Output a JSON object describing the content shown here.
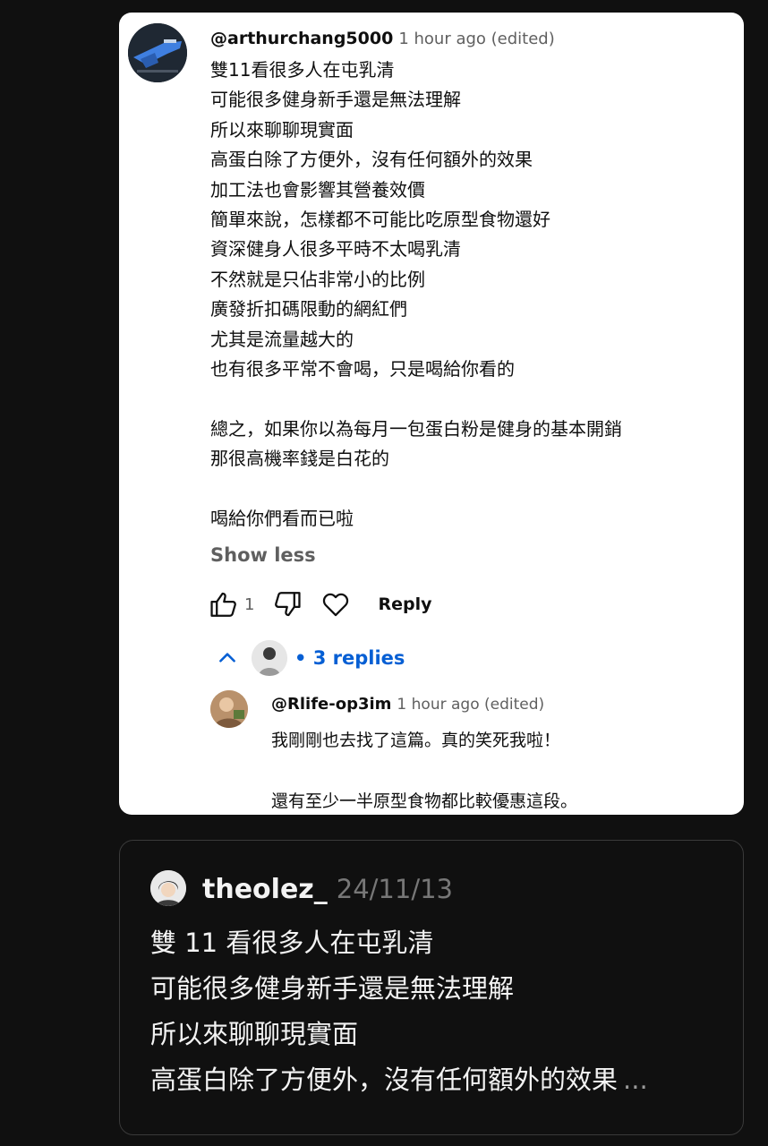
{
  "youtube_comment": {
    "handle": "@arthurchang5000",
    "meta": "1 hour ago (edited)",
    "body_lines": [
      "雙11看很多人在屯乳清",
      "可能很多健身新手還是無法理解",
      "所以來聊聊現實面",
      "高蛋白除了方便外，沒有任何額外的效果",
      "加工法也會影響其營養效價",
      "簡單來說，怎樣都不可能比吃原型食物還好",
      "資深健身人很多平時不太喝乳清",
      "不然就是只佔非常小的比例",
      "廣發折扣碼限動的網紅們",
      "尤其是流量越大的",
      "也有很多平常不會喝，只是喝給你看的",
      "",
      "總之，如果你以為每月一包蛋白粉是健身的基本開銷",
      "那很高機率錢是白花的",
      "",
      "喝給你們看而已啦"
    ],
    "show_less": "Show less",
    "like_count": "1",
    "reply_label": "Reply",
    "replies_label": "• 3 replies",
    "reply": {
      "handle": "@Rlife-op3im",
      "meta": "1 hour ago (edited)",
      "body_lines": [
        "我剛剛也去找了這篇。真的笑死我啦！",
        "",
        "還有至少一半原型食物都比較優惠這段。"
      ]
    },
    "colors": {
      "link_blue": "#065fd4",
      "meta_gray": "#606060"
    }
  },
  "threads_post": {
    "username": "theolez_",
    "date": "24/11/13",
    "body_lines": [
      "雙 11 看很多人在屯乳清",
      "可能很多健身新手還是無法理解",
      "所以來聊聊現實面",
      "高蛋白除了方便外，沒有任何額外的效果"
    ],
    "more": "..."
  }
}
